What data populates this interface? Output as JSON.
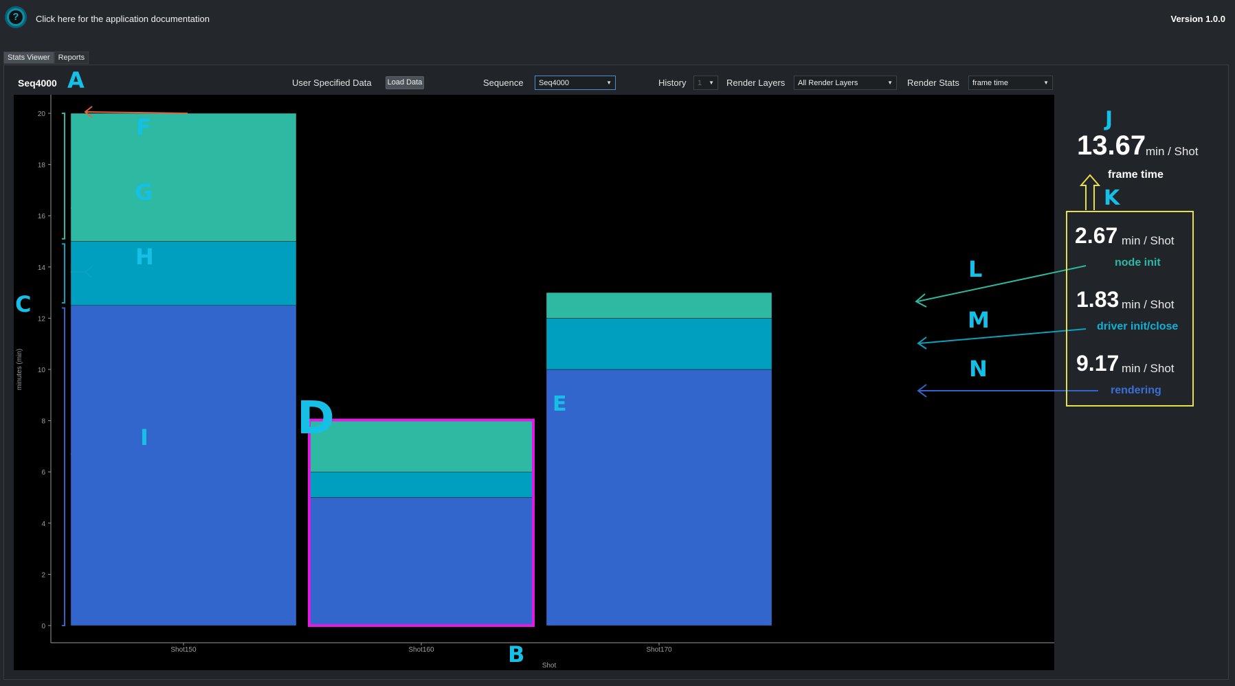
{
  "header": {
    "help_icon": "question-icon",
    "doc_link": "Click here for the application documentation",
    "version": "Version 1.0.0"
  },
  "tabs": [
    {
      "label": "Stats Viewer",
      "active": true
    },
    {
      "label": "Reports",
      "active": false
    }
  ],
  "toolbar": {
    "sequence_title": "Seq4000",
    "user_data_label": "User Specified Data",
    "load_button": "Load Data",
    "sequence_label": "Sequence",
    "sequence_value": "Seq4000",
    "history_label": "History",
    "history_value": "1",
    "render_layers_label": "Render Layers",
    "render_layers_value": "All Render Layers",
    "render_stats_label": "Render Stats",
    "render_stats_value": "frame time"
  },
  "chart_data": {
    "type": "bar",
    "stacked": true,
    "categories": [
      "Shot150",
      "Shot160",
      "Shot170"
    ],
    "xlabel": "Shot",
    "ylabel": "minutes (min)",
    "ylim": [
      0,
      20
    ],
    "yticks": [
      0,
      2,
      4,
      6,
      8,
      10,
      12,
      14,
      16,
      18,
      20
    ],
    "grid": false,
    "series": [
      {
        "name": "rendering",
        "color": "#3266cc",
        "values": [
          12.5,
          5,
          10
        ]
      },
      {
        "name": "driver init/close",
        "color": "#009fbf",
        "values": [
          2.5,
          1,
          2
        ]
      },
      {
        "name": "node init",
        "color": "#2ebaa2",
        "values": [
          5,
          2,
          1
        ]
      }
    ],
    "highlighted_category": "Shot160"
  },
  "annotations": {
    "A": "A",
    "B": "B",
    "C": "C",
    "D": "D",
    "E": "E",
    "F": "F",
    "G": "G",
    "H": "H",
    "I": "I",
    "J": "J",
    "K": "K",
    "L": "L",
    "M": "M",
    "N": "N"
  },
  "colors": {
    "annotation": "#16bfe6",
    "highlight_border": "#e21be2",
    "yellow_box": "#e8e048",
    "arrow_F": "#e8603c",
    "arrow_G": "#2ebaa2",
    "arrow_H": "#0aa3bf",
    "arrow_I": "#3266cc"
  },
  "stats": {
    "total": {
      "value": "13.67",
      "unit": "min / Shot",
      "name": "frame time",
      "color": "#ffffff"
    },
    "breakdown": [
      {
        "value": "2.67",
        "unit": "min / Shot",
        "name": "node init",
        "color": "#2ebaa2"
      },
      {
        "value": "1.83",
        "unit": "min / Shot",
        "name": "driver init/close",
        "color": "#13b0d4"
      },
      {
        "value": "9.17",
        "unit": "min / Shot",
        "name": "rendering",
        "color": "#3a6fd8"
      }
    ]
  }
}
